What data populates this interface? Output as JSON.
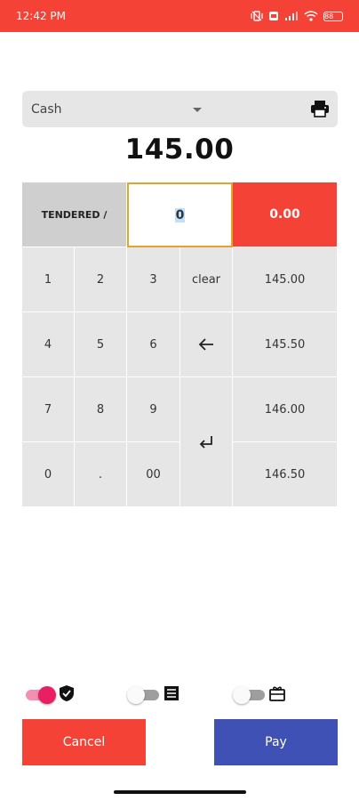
{
  "status_bar": {
    "time": "12:42 PM",
    "battery": "88",
    "icons": [
      "vibrate-icon",
      "sim-icon",
      "signal-icon",
      "wifi-icon",
      "battery-icon"
    ]
  },
  "payment": {
    "method": "Cash",
    "total": "145.00"
  },
  "tender": {
    "label": "TENDERED /",
    "input_value": "0",
    "change": "0.00"
  },
  "keypad": {
    "k1": "1",
    "k2": "2",
    "k3": "3",
    "clear": "clear",
    "k4": "4",
    "k5": "5",
    "k6": "6",
    "k7": "7",
    "k8": "8",
    "k9": "9",
    "k0": "0",
    "dot": ".",
    "k00": "00",
    "quick": [
      "145.00",
      "145.50",
      "146.00",
      "146.50"
    ]
  },
  "toggles": [
    {
      "name": "secure",
      "on": true,
      "icon": "shield-check-icon"
    },
    {
      "name": "receipt",
      "on": false,
      "icon": "receipt-list-icon"
    },
    {
      "name": "gift",
      "on": false,
      "icon": "gift-card-icon"
    }
  ],
  "colors": {
    "accent_red": "#f44336",
    "pay_blue": "#3f51b5",
    "toggle_on": "#e91e63",
    "input_border": "#e0a530"
  },
  "actions": {
    "cancel": "Cancel",
    "pay": "Pay"
  }
}
